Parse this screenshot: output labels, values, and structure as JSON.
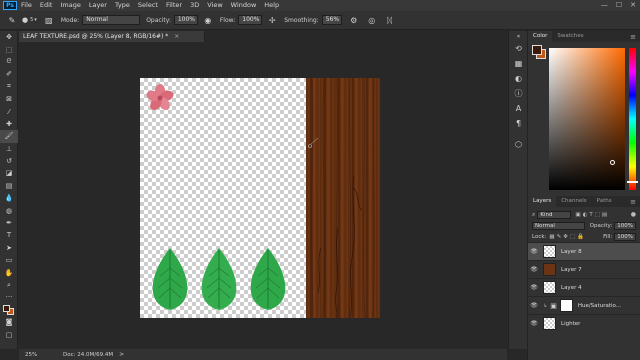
{
  "menu": {
    "app_logo": "Ps",
    "items": [
      "File",
      "Edit",
      "Image",
      "Layer",
      "Type",
      "Select",
      "Filter",
      "3D",
      "View",
      "Window",
      "Help"
    ],
    "window_controls": [
      "—",
      "☐",
      "✕"
    ]
  },
  "options": {
    "brush_size": "5",
    "mode_label": "Mode:",
    "mode_value": "Normal",
    "opacity_label": "Opacity:",
    "opacity_value": "100%",
    "flow_label": "Flow:",
    "flow_value": "100%",
    "smoothing_label": "Smoothing:",
    "smoothing_value": "56%"
  },
  "document": {
    "tab_title": "LEAF TEXTURE.psd @ 25% (Layer 8, RGB/16#) *",
    "close": "×"
  },
  "status": {
    "zoom": "25%",
    "doc_size": "Doc: 24.0M/69.4M",
    "arrow": ">"
  },
  "panels": {
    "color_tabs": [
      "Color",
      "Swatches"
    ],
    "layers_tabs": [
      "Layers",
      "Channels",
      "Paths"
    ],
    "kind_value": "Kind",
    "blend_value": "Normal",
    "opacity_label": "Opacity:",
    "opacity_value": "100%",
    "lock_label": "Lock:",
    "fill_label": "Fill:",
    "fill_value": "100%",
    "layers": [
      {
        "name": "Layer 8",
        "selected": true
      },
      {
        "name": "Layer 7",
        "selected": false
      },
      {
        "name": "Layer 4",
        "selected": false
      },
      {
        "name": "Hue/Saturatio...",
        "selected": false
      },
      {
        "name": "Lighter",
        "selected": false
      }
    ]
  },
  "colors": {
    "foreground": "#3b1a0a",
    "background": "#c05a1c",
    "leaf": "#2fa84a",
    "flower": "#e07a86"
  },
  "icons": {
    "tools": [
      "move-icon",
      "marquee-icon",
      "lasso-icon",
      "quick-select-icon",
      "crop-icon",
      "frame-icon",
      "eyedropper-icon",
      "healing-icon",
      "brush-icon",
      "clone-stamp-icon",
      "history-brush-icon",
      "eraser-icon",
      "gradient-icon",
      "blur-icon",
      "dodge-icon",
      "pen-icon",
      "type-icon",
      "path-select-icon",
      "shape-icon",
      "hand-icon",
      "zoom-icon",
      "more-icon",
      "fg-bg-colors-icon",
      "quick-mask-icon",
      "screen-mode-icon"
    ]
  }
}
